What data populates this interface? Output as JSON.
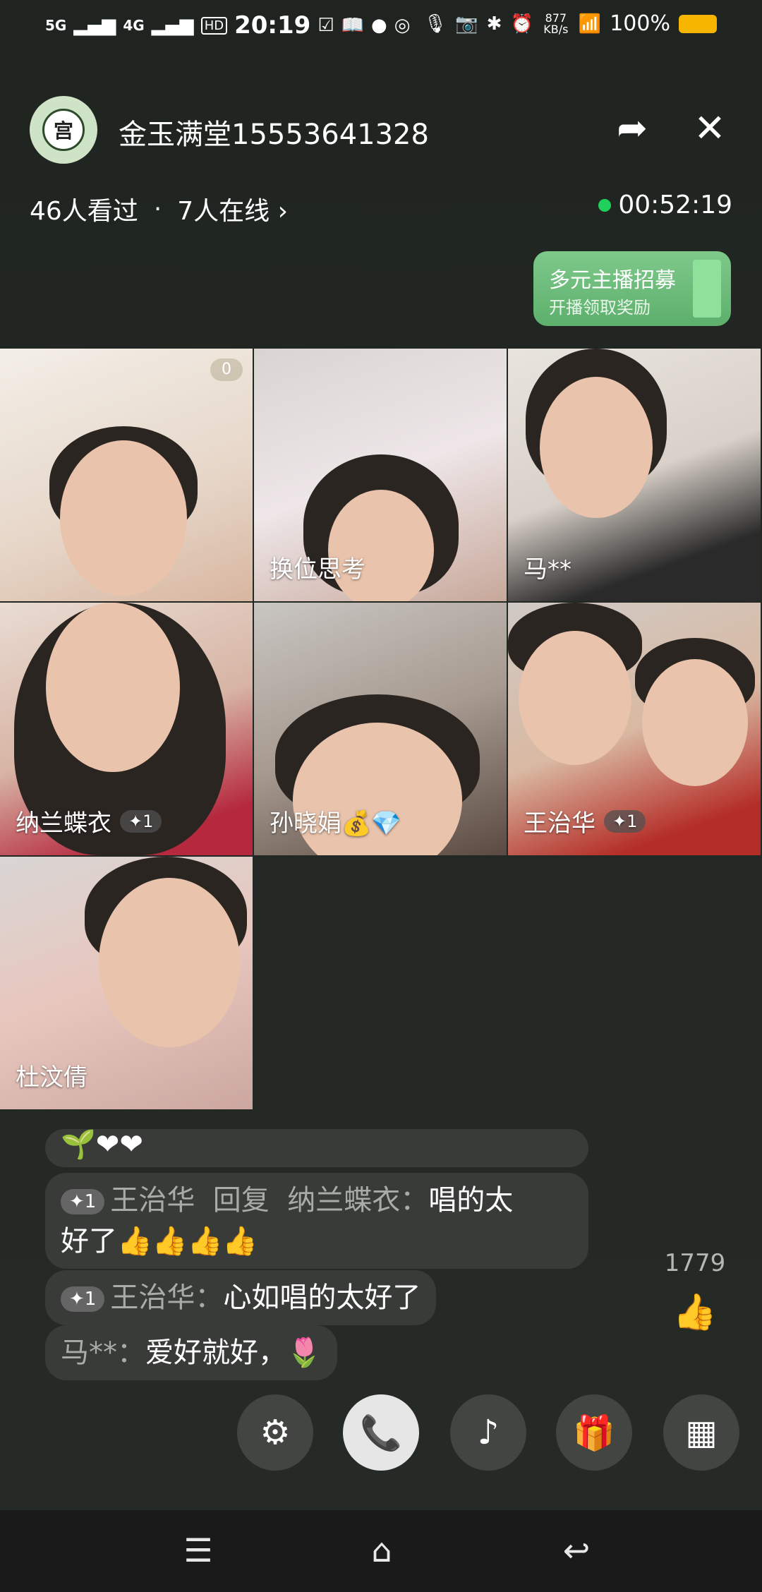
{
  "status_bar": {
    "signal1": "5G",
    "signal2": "4G",
    "hd": "HD",
    "time": "20:19",
    "net_speed": "877 KB/s",
    "battery": "100%"
  },
  "header": {
    "avatar_text": "宫",
    "title": "金玉满堂15553641328"
  },
  "stats": {
    "viewers": "46人看过",
    "separator": "·",
    "online": "7人在线 ›",
    "timer": "00:52:19"
  },
  "promo": {
    "title": "多元主播招募",
    "subtitle": "开播领取奖励"
  },
  "tiles": [
    {
      "name": "",
      "badge": "0"
    },
    {
      "name": "换位思考"
    },
    {
      "name": "马**"
    },
    {
      "name": "纳兰蝶衣",
      "plus": "✦1"
    },
    {
      "name": "孙晓娟💰💎"
    },
    {
      "name": "王治华",
      "plus": "✦1"
    },
    {
      "name": "杜汶倩"
    }
  ],
  "chat": {
    "msg0": "🌱❤❤",
    "msg1": {
      "badge": "✦1",
      "user": "王治华",
      "reply": "回复",
      "target": "纳兰蝶衣：",
      "text": "唱的太",
      "text2": "好了👍👍👍👍"
    },
    "msg2": {
      "badge": "✦1",
      "user": "王治华：",
      "text": "心如唱的太好了"
    },
    "msg3": {
      "user": "马**：",
      "text": "爱好就好，🌷"
    }
  },
  "likes": {
    "count": "1779"
  },
  "icons": {
    "share": "share-icon",
    "close": "close-icon",
    "like": "thumbs-up-icon",
    "settings": "sliders-icon",
    "call": "phone-video-icon",
    "music": "music-note-icon",
    "gift": "gift-bag-icon",
    "apps": "apps-grid-icon"
  }
}
